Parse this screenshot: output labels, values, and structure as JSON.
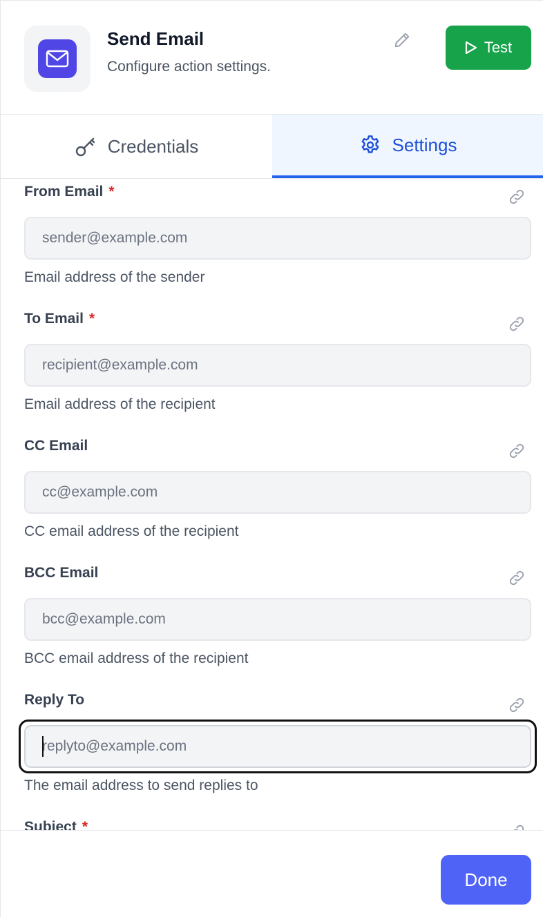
{
  "header": {
    "title": "Send Email",
    "subtitle": "Configure action settings.",
    "test_label": "Test",
    "app_icon": "mail-icon",
    "accent_color": "#4f46e5",
    "test_color": "#16a34a"
  },
  "tabs": [
    {
      "label": "Credentials",
      "icon": "key-icon",
      "active": false
    },
    {
      "label": "Settings",
      "icon": "gear-icon",
      "active": true
    }
  ],
  "fields": [
    {
      "label": "From Email",
      "required": true,
      "placeholder": "sender@example.com",
      "help": "Email address of the sender"
    },
    {
      "label": "To Email",
      "required": true,
      "placeholder": "recipient@example.com",
      "help": "Email address of the recipient"
    },
    {
      "label": "CC Email",
      "required": false,
      "placeholder": "cc@example.com",
      "help": "CC email address of the recipient"
    },
    {
      "label": "BCC Email",
      "required": false,
      "placeholder": "bcc@example.com",
      "help": "BCC email address of the recipient"
    },
    {
      "label": "Reply To",
      "required": false,
      "placeholder": "replyto@example.com",
      "help": "The email address to send replies to",
      "focused": true
    },
    {
      "label": "Subject",
      "required": true
    }
  ],
  "required_marker": "*",
  "footer": {
    "done_label": "Done",
    "done_color": "#4f63f6"
  }
}
